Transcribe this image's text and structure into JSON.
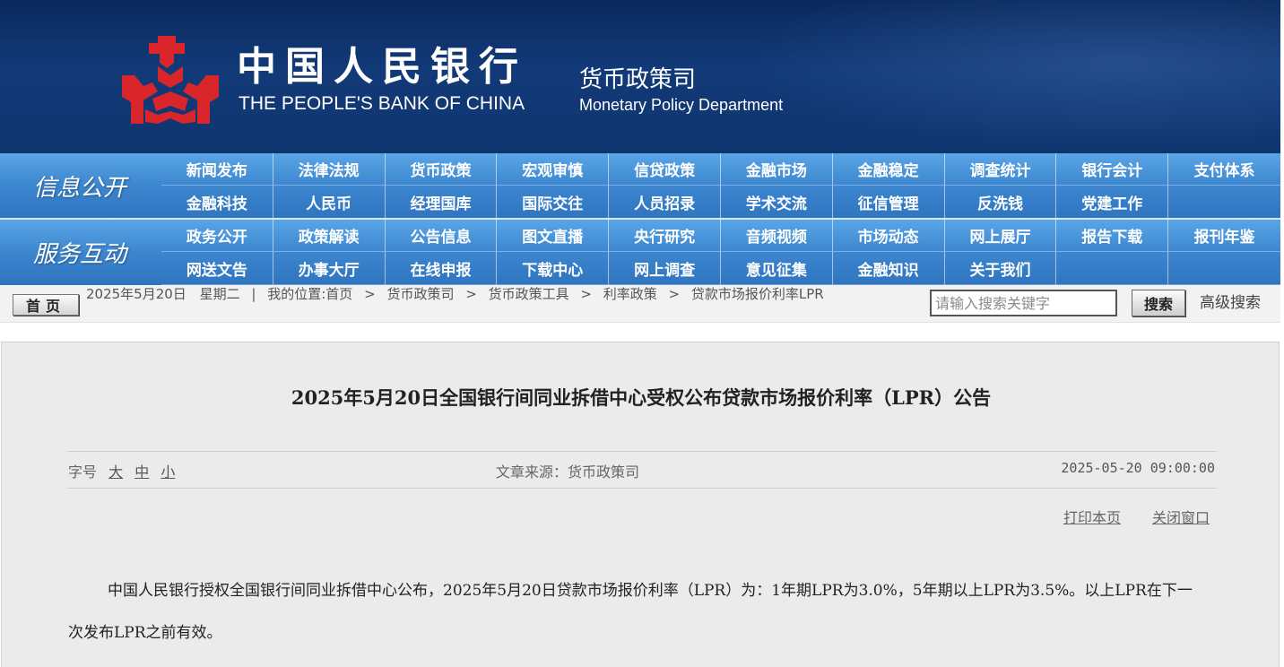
{
  "header": {
    "bank_name_cn": "中国人民银行",
    "bank_name_en": "THE PEOPLE'S BANK OF CHINA",
    "dept_name_cn": "货币政策司",
    "dept_name_en": "Monetary Policy Department",
    "logo_icon": "pboc-logo-icon",
    "colors": {
      "banner": "#0f356f",
      "logo_red": "#d8262a",
      "nav": "#3c86cf"
    }
  },
  "nav": {
    "info_title": "信息公开",
    "info_items": [
      "新闻发布",
      "法律法规",
      "货币政策",
      "宏观审慎",
      "信贷政策",
      "金融市场",
      "金融稳定",
      "调查统计",
      "银行会计",
      "支付体系",
      "金融科技",
      "人民币",
      "经理国库",
      "国际交往",
      "人员招录",
      "学术交流",
      "征信管理",
      "反洗钱",
      "党建工作"
    ],
    "service_title": "服务互动",
    "service_items": [
      "政务公开",
      "政策解读",
      "公告信息",
      "图文直播",
      "央行研究",
      "音频视频",
      "市场动态",
      "网上展厅",
      "报告下载",
      "报刊年鉴",
      "网送文告",
      "办事大厅",
      "在线申报",
      "下载中心",
      "网上调查",
      "意见征集",
      "金融知识",
      "关于我们"
    ]
  },
  "crumb": {
    "home_label": "首页",
    "date": "2025年5月20日",
    "weekday": "星期二",
    "divider": "|",
    "location_prefix": "我的位置:首页",
    "path": [
      "货币政策司",
      "货币政策工具",
      "利率政策",
      "贷款市场报价利率LPR"
    ],
    "separator": ">"
  },
  "search": {
    "placeholder": "请输入搜索关键字",
    "button_label": "搜索",
    "advanced_label": "高级搜索"
  },
  "article": {
    "title": "2025年5月20日全国银行间同业拆借中心受权公布贷款市场报价利率（LPR）公告",
    "font_size_label": "字号",
    "font_size_options": [
      "大",
      "中",
      "小"
    ],
    "source": "文章来源：货币政策司",
    "date": "2025-05-20 09:00:00",
    "print_label": "打印本页",
    "close_label": "关闭窗口",
    "body": "中国人民银行授权全国银行间同业拆借中心公布，2025年5月20日贷款市场报价利率（LPR）为：1年期LPR为3.0%，5年期以上LPR为3.5%。以上LPR在下一次发布LPR之前有效。"
  }
}
